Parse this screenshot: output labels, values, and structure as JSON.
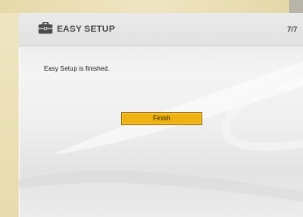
{
  "header": {
    "title": "EASY SETUP",
    "step": "7/7",
    "icon": "toolbox-icon"
  },
  "main": {
    "message": "Easy Setup is finished.",
    "finish_label": "Finish"
  },
  "colors": {
    "accent": "#eeb211",
    "panel": "#ececec",
    "outer_background": "#e9ddb3",
    "text": "#4a4a4a"
  }
}
